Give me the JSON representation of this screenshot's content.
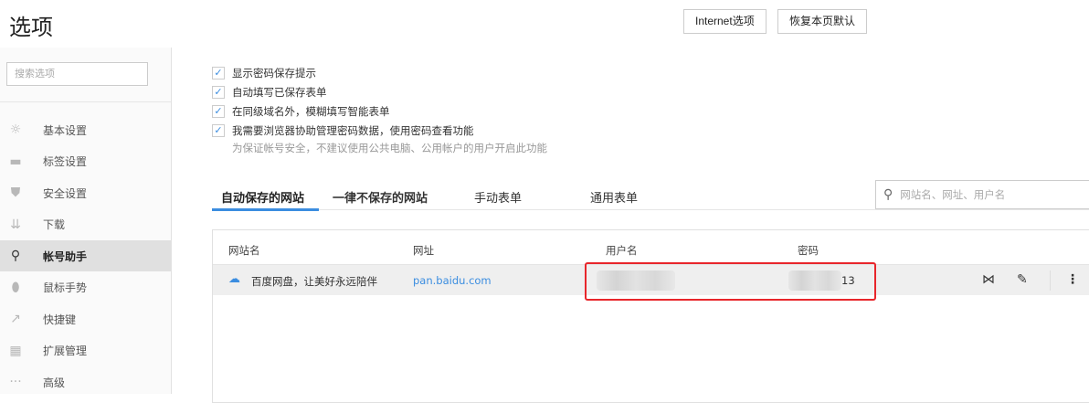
{
  "header": {
    "title": "选项",
    "buttons": [
      "Internet选项",
      "恢复本页默认"
    ]
  },
  "sidebar": {
    "search_placeholder": "搜索选项",
    "items": [
      {
        "label": "基本设置",
        "icon": "gear-icon",
        "glyph": "☼"
      },
      {
        "label": "标签设置",
        "icon": "tab-icon",
        "glyph": "▬"
      },
      {
        "label": "安全设置",
        "icon": "shield-icon",
        "glyph": "⛊"
      },
      {
        "label": "下载",
        "icon": "download-icon",
        "glyph": "⇊"
      },
      {
        "label": "帐号助手",
        "icon": "key-icon",
        "glyph": "⚲"
      },
      {
        "label": "鼠标手势",
        "icon": "mouse-icon",
        "glyph": "⬮"
      },
      {
        "label": "快捷键",
        "icon": "shortcut-icon",
        "glyph": "↗"
      },
      {
        "label": "扩展管理",
        "icon": "extensions-icon",
        "glyph": "▦"
      },
      {
        "label": "高级",
        "icon": "more-icon",
        "glyph": "···"
      }
    ],
    "active": 4
  },
  "options": {
    "checkboxes": [
      {
        "label": "显示密码保存提示",
        "checked": true
      },
      {
        "label": "自动填写已保存表单",
        "checked": true
      },
      {
        "label": "在同级域名外，模糊填写智能表单",
        "checked": true
      },
      {
        "label": "我需要浏览器协助管理密码数据，使用密码查看功能",
        "checked": true
      }
    ],
    "hint": "为保证帐号安全，不建议使用公共电脑、公用帐户的用户开启此功能"
  },
  "tabs": [
    "自动保存的网站",
    "一律不保存的网站",
    "手动表单",
    "通用表单"
  ],
  "search": {
    "placeholder": "网站名、网址、用户名"
  },
  "table": {
    "headers": [
      "网站名",
      "网址",
      "用户名",
      "密码"
    ],
    "rows": [
      {
        "site": "百度网盘，让美好永远陪伴",
        "url": "pan.baidu.com",
        "username": "",
        "password_suffix": "13"
      }
    ]
  },
  "colors": {
    "accent": "#3b8de0",
    "highlight": "#e8262b"
  }
}
